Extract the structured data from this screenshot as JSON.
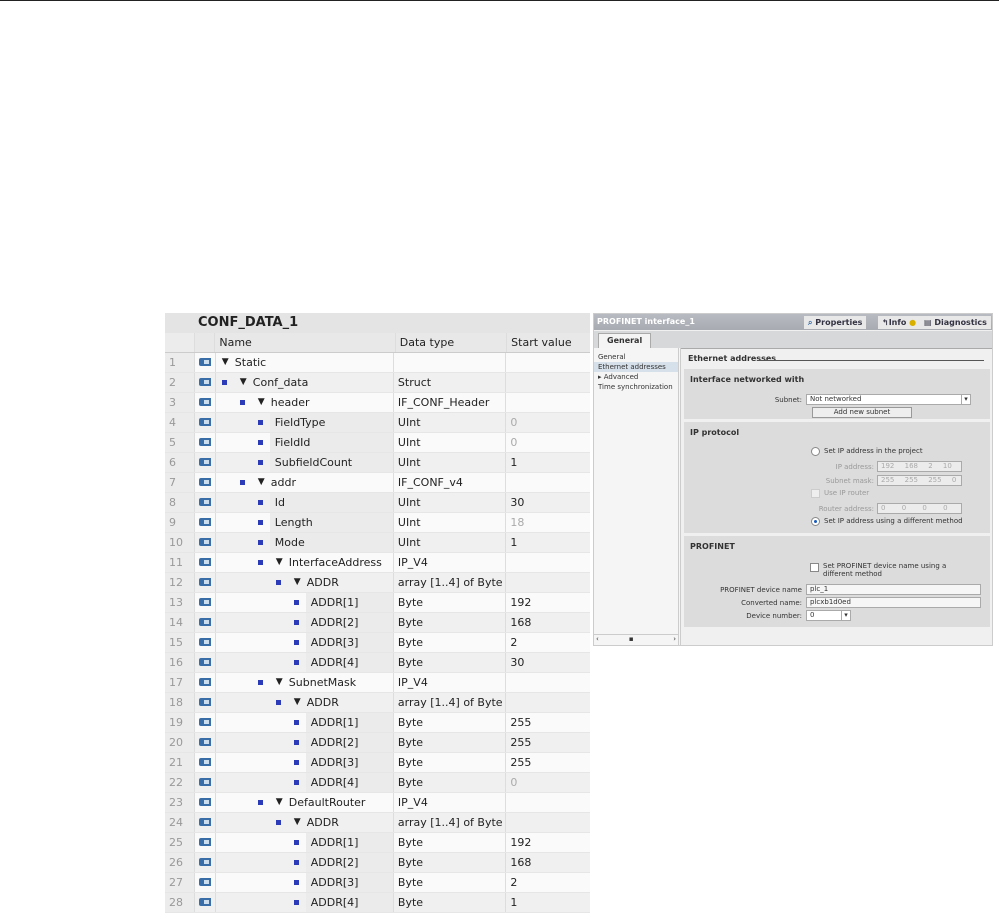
{
  "table": {
    "title": "CONF_DATA_1",
    "columns": [
      "Name",
      "Data type",
      "Start value"
    ],
    "rows": [
      {
        "n": "1",
        "name": "Static",
        "level": 0,
        "expand": true,
        "type": "",
        "val": "",
        "grey": false
      },
      {
        "n": "2",
        "name": "Conf_data",
        "level": 1,
        "expand": true,
        "type": "Struct",
        "val": "",
        "grey": false
      },
      {
        "n": "3",
        "name": "header",
        "level": 2,
        "expand": true,
        "type": "IF_CONF_Header",
        "val": "",
        "grey": false
      },
      {
        "n": "4",
        "name": "FieldType",
        "level": 3,
        "expand": false,
        "type": "UInt",
        "val": "0",
        "grey": true
      },
      {
        "n": "5",
        "name": "FieldId",
        "level": 3,
        "expand": false,
        "type": "UInt",
        "val": "0",
        "grey": true
      },
      {
        "n": "6",
        "name": "SubfieldCount",
        "level": 3,
        "expand": false,
        "type": "UInt",
        "val": "1",
        "grey": false
      },
      {
        "n": "7",
        "name": "addr",
        "level": 2,
        "expand": true,
        "type": "IF_CONF_v4",
        "val": "",
        "grey": false
      },
      {
        "n": "8",
        "name": "Id",
        "level": 3,
        "expand": false,
        "type": "UInt",
        "val": "30",
        "grey": false
      },
      {
        "n": "9",
        "name": "Length",
        "level": 3,
        "expand": false,
        "type": "UInt",
        "val": "18",
        "grey": true
      },
      {
        "n": "10",
        "name": "Mode",
        "level": 3,
        "expand": false,
        "type": "UInt",
        "val": "1",
        "grey": false
      },
      {
        "n": "11",
        "name": "InterfaceAddress",
        "level": 3,
        "expand": true,
        "type": "IP_V4",
        "val": "",
        "grey": false
      },
      {
        "n": "12",
        "name": "ADDR",
        "level": 4,
        "expand": true,
        "type": "array [1..4] of Byte",
        "val": "",
        "grey": false
      },
      {
        "n": "13",
        "name": "ADDR[1]",
        "level": 5,
        "expand": false,
        "type": "Byte",
        "val": "192",
        "grey": false
      },
      {
        "n": "14",
        "name": "ADDR[2]",
        "level": 5,
        "expand": false,
        "type": "Byte",
        "val": "168",
        "grey": false
      },
      {
        "n": "15",
        "name": "ADDR[3]",
        "level": 5,
        "expand": false,
        "type": "Byte",
        "val": "2",
        "grey": false
      },
      {
        "n": "16",
        "name": "ADDR[4]",
        "level": 5,
        "expand": false,
        "type": "Byte",
        "val": "30",
        "grey": false
      },
      {
        "n": "17",
        "name": "SubnetMask",
        "level": 3,
        "expand": true,
        "type": "IP_V4",
        "val": "",
        "grey": false
      },
      {
        "n": "18",
        "name": "ADDR",
        "level": 4,
        "expand": true,
        "type": "array [1..4] of Byte",
        "val": "",
        "grey": false
      },
      {
        "n": "19",
        "name": "ADDR[1]",
        "level": 5,
        "expand": false,
        "type": "Byte",
        "val": "255",
        "grey": false
      },
      {
        "n": "20",
        "name": "ADDR[2]",
        "level": 5,
        "expand": false,
        "type": "Byte",
        "val": "255",
        "grey": false
      },
      {
        "n": "21",
        "name": "ADDR[3]",
        "level": 5,
        "expand": false,
        "type": "Byte",
        "val": "255",
        "grey": false
      },
      {
        "n": "22",
        "name": "ADDR[4]",
        "level": 5,
        "expand": false,
        "type": "Byte",
        "val": "0",
        "grey": true
      },
      {
        "n": "23",
        "name": "DefaultRouter",
        "level": 3,
        "expand": true,
        "type": "IP_V4",
        "val": "",
        "grey": false
      },
      {
        "n": "24",
        "name": "ADDR",
        "level": 4,
        "expand": true,
        "type": "array [1..4] of Byte",
        "val": "",
        "grey": false
      },
      {
        "n": "25",
        "name": "ADDR[1]",
        "level": 5,
        "expand": false,
        "type": "Byte",
        "val": "192",
        "grey": false
      },
      {
        "n": "26",
        "name": "ADDR[2]",
        "level": 5,
        "expand": false,
        "type": "Byte",
        "val": "168",
        "grey": false
      },
      {
        "n": "27",
        "name": "ADDR[3]",
        "level": 5,
        "expand": false,
        "type": "Byte",
        "val": "2",
        "grey": false
      },
      {
        "n": "28",
        "name": "ADDR[4]",
        "level": 5,
        "expand": false,
        "type": "Byte",
        "val": "1",
        "grey": false
      }
    ]
  },
  "props": {
    "title": "PROFINET interface_1",
    "tabs": {
      "properties": "Properties",
      "info": "Info",
      "diagnostics": "Diagnostics"
    },
    "general_tab": "General",
    "nav": [
      "General",
      "Ethernet addresses",
      "Advanced",
      "Time synchronization"
    ],
    "section_title": "Ethernet addresses",
    "networked": {
      "title": "Interface networked with",
      "subnet_label": "Subnet:",
      "subnet_value": "Not networked",
      "add_button": "Add new subnet"
    },
    "ip": {
      "title": "IP protocol",
      "opt_project": "Set IP address in the project",
      "ip_label": "IP address:",
      "ip": [
        "192",
        "168",
        "2",
        "10"
      ],
      "mask_label": "Subnet mask:",
      "mask": [
        "255",
        "255",
        "255",
        "0"
      ],
      "use_router": "Use IP router",
      "router_label": "Router address:",
      "router": [
        "0",
        "0",
        "0",
        "0"
      ],
      "opt_other": "Set IP address using a different method"
    },
    "profinet": {
      "title": "PROFINET",
      "chk_label": "Set PROFINET device name using a different method",
      "name_label": "PROFINET device name",
      "name_value": "plc_1",
      "conv_label": "Converted name:",
      "conv_value": "plcxb1d0ed",
      "num_label": "Device number:",
      "num_value": "0"
    }
  }
}
